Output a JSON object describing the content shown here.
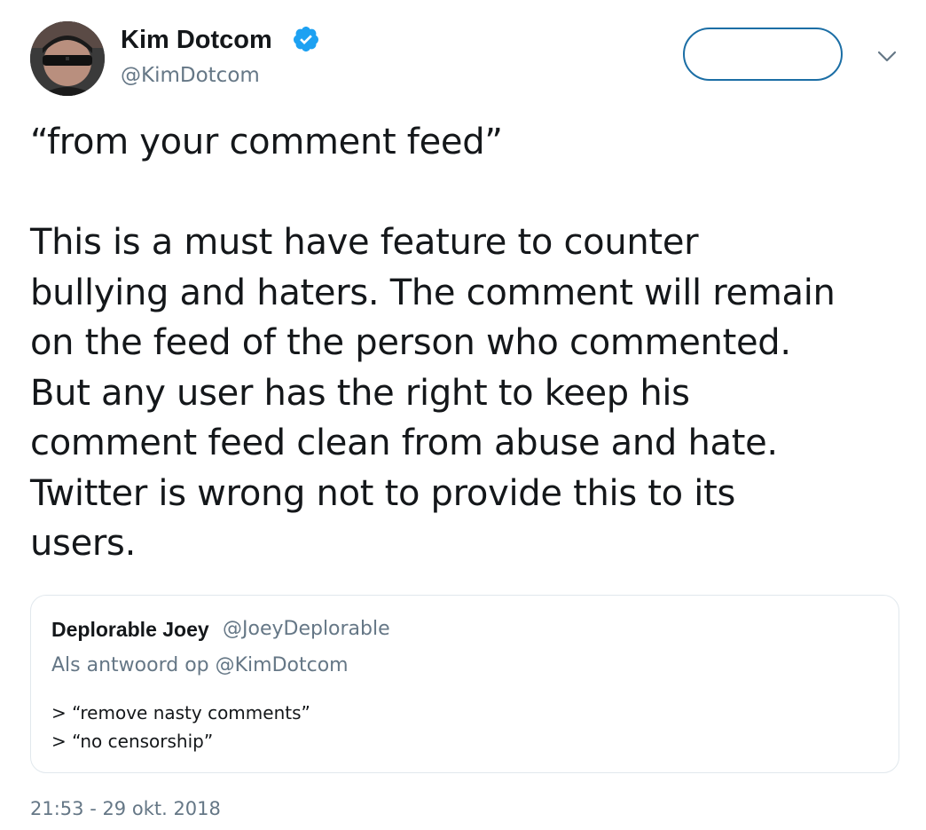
{
  "author": {
    "display_name": "Kim Dotcom",
    "handle": "@KimDotcom",
    "verified": true,
    "avatar_icon": "user-avatar-sunglasses"
  },
  "follow_button": {
    "label": ""
  },
  "menu": {
    "icon": "chevron-down-icon"
  },
  "tweet": {
    "text": "“from your comment feed”\n\nThis is a must have feature to counter bullying and haters. The comment will remain on the feed of the person who commented. But any user has the right to keep his comment feed clean from abuse and hate. Twitter is wrong not to provide this to its users.",
    "lines": [
      "“from your comment feed”",
      "",
      "This is a must have feature to counter",
      "bullying and haters. The comment will remain",
      "on the feed of the person who commented.",
      "But any user has the right to keep his",
      "comment feed clean from abuse and hate.",
      "Twitter is wrong not to provide this to its",
      "users."
    ]
  },
  "quoted_tweet": {
    "display_name": "Deplorable Joey",
    "handle": "@JoeyDeplorable",
    "reply_context": "Als antwoord op @KimDotcom",
    "lines": [
      "> “remove nasty comments”",
      "> “no censorship”"
    ]
  },
  "timestamp": "21:53 - 29 okt. 2018",
  "colors": {
    "text_primary": "#14171a",
    "text_secondary": "#657786",
    "verified_badge": "#1da1f2",
    "follow_border": "#1b6ea5",
    "card_border": "#e1e8ed"
  }
}
